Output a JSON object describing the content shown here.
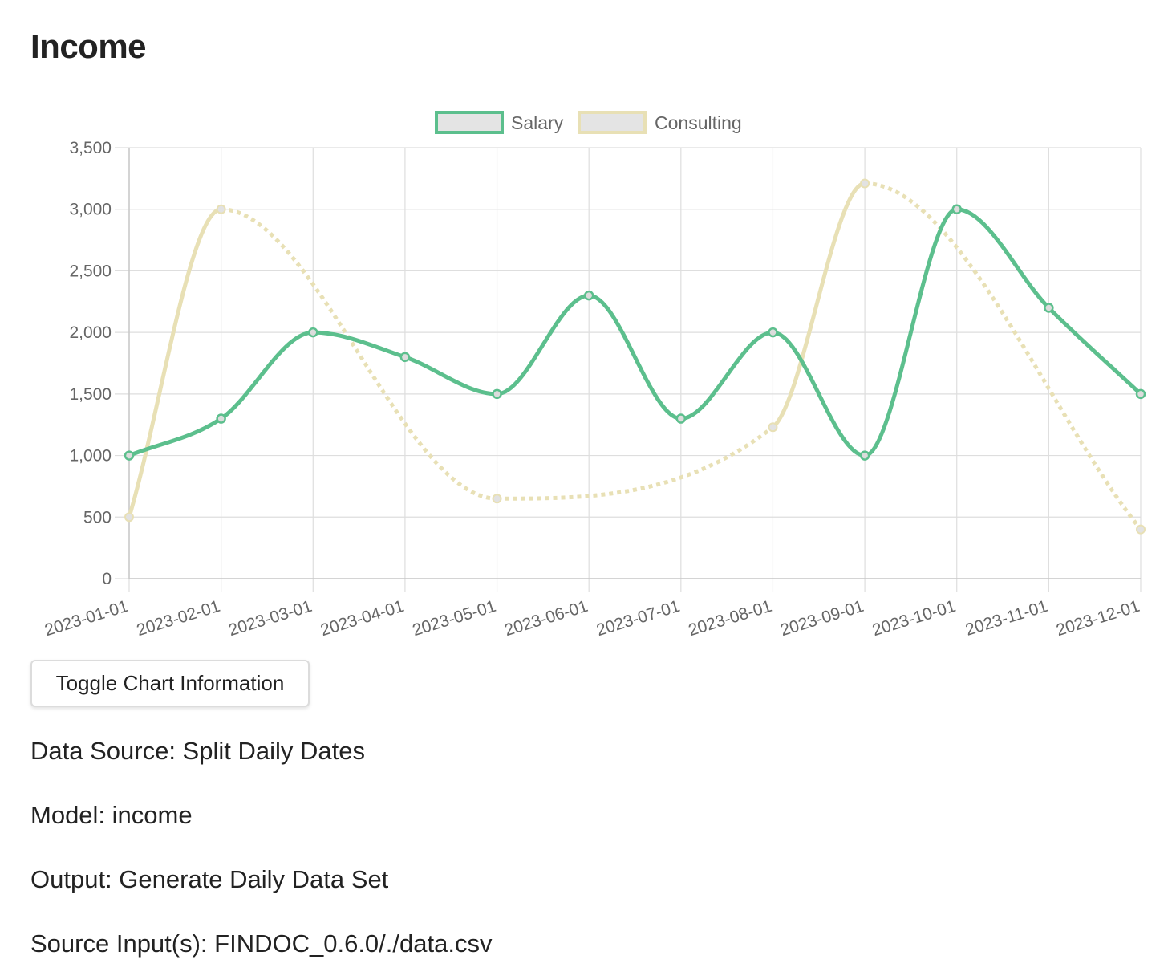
{
  "page": {
    "title": "Income"
  },
  "chart_data": {
    "type": "line",
    "x": [
      "2023-01-01",
      "2023-02-01",
      "2023-03-01",
      "2023-04-01",
      "2023-05-01",
      "2023-06-01",
      "2023-07-01",
      "2023-08-01",
      "2023-09-01",
      "2023-10-01",
      "2023-11-01",
      "2023-12-01"
    ],
    "series": [
      {
        "name": "Salary",
        "color": "#5cbf8d",
        "style": "solid",
        "values": [
          1000,
          1300,
          2000,
          1800,
          1500,
          2300,
          1300,
          2000,
          1000,
          3000,
          2200,
          1500
        ],
        "points": [
          0,
          1,
          2,
          3,
          4,
          5,
          6,
          7,
          8,
          9,
          10,
          11
        ]
      },
      {
        "name": "Consulting",
        "color": "#e8e0b5",
        "style": "solid-dotted",
        "values": [
          500,
          3000,
          null,
          null,
          650,
          null,
          null,
          1230,
          3210,
          null,
          null,
          400
        ],
        "points": [
          0,
          1,
          4,
          7,
          8,
          11
        ]
      }
    ],
    "yticks": [
      0,
      500,
      1000,
      1500,
      2000,
      2500,
      3000,
      3500
    ],
    "ylim": [
      0,
      3500
    ],
    "grid": true,
    "legend": "top-center"
  },
  "toggle_button": {
    "label": "Toggle Chart Information"
  },
  "info": {
    "data_source": "Data Source: Split Daily Dates",
    "model": "Model: income",
    "output": "Output: Generate Daily Data Set",
    "source_inputs": "Source Input(s): FINDOC_0.6.0/./data.csv"
  }
}
